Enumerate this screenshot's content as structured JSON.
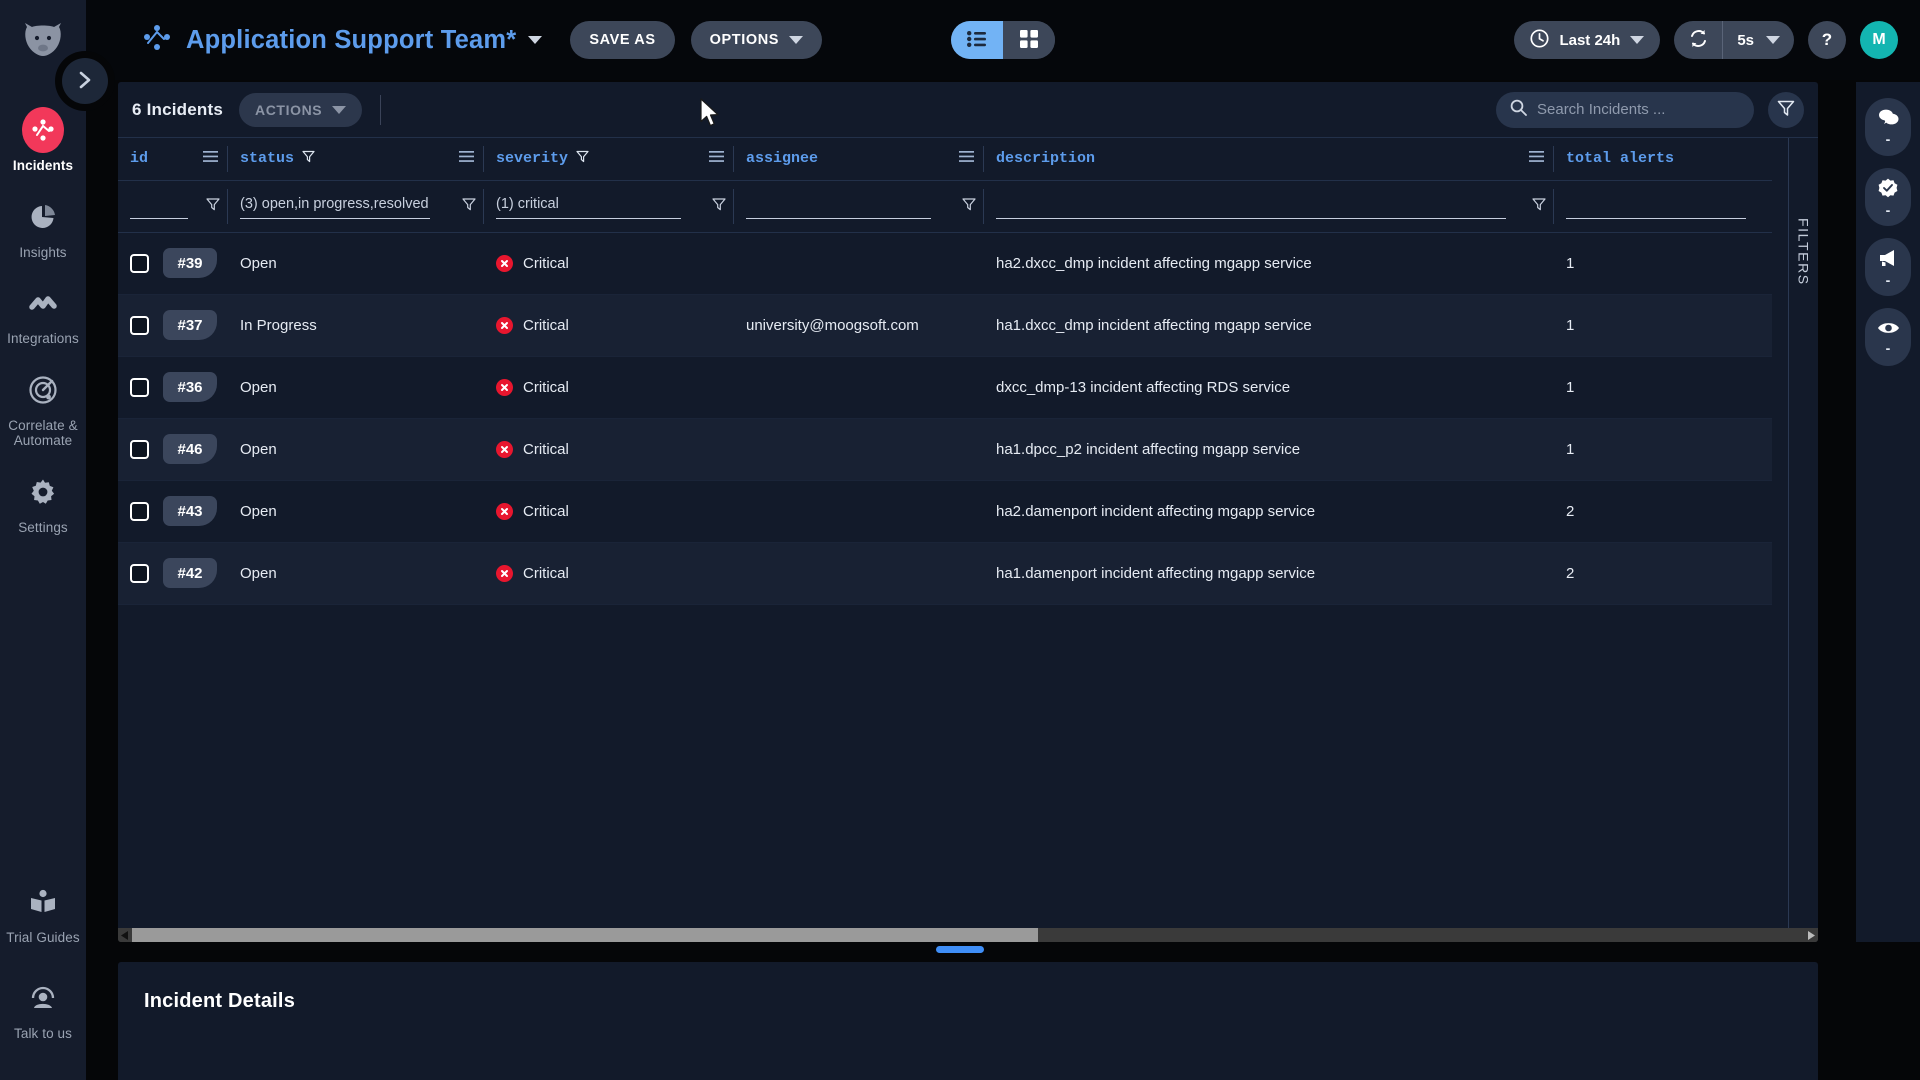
{
  "app": {
    "brand_icon": "moogsoft-cow-logo",
    "accent_blue": "#5d9cec",
    "accent_red": "#f2385a",
    "critical_red": "#e8162e",
    "avatar_teal": "#13b5b1",
    "panel_bg": "#121a2a"
  },
  "sidebar": {
    "collapse_icon": "chevron-right-icon",
    "items": [
      {
        "label": "Incidents",
        "icon": "incidents-icon",
        "active": true
      },
      {
        "label": "Insights",
        "icon": "pie-chart-icon",
        "active": false
      },
      {
        "label": "Integrations",
        "icon": "integrations-icon",
        "active": false
      },
      {
        "label": "Correlate & Automate",
        "icon": "target-icon",
        "active": false
      },
      {
        "label": "Settings",
        "icon": "gear-icon",
        "active": false
      }
    ],
    "bottom_items": [
      {
        "label": "Trial Guides",
        "icon": "book-icon"
      },
      {
        "label": "Talk to us",
        "icon": "headset-icon"
      }
    ]
  },
  "topbar": {
    "dashboard_title": "Application Support Team*",
    "dashboard_caret": "chevron-down-icon",
    "save_as_label": "SAVE AS",
    "options_label": "OPTIONS",
    "view_toggle": {
      "list_icon": "list-view-icon",
      "grid_icon": "grid-view-icon",
      "active": "list"
    },
    "time_range": {
      "icon": "clock-icon",
      "label": "Last 24h",
      "caret": "chevron-down-icon"
    },
    "refresh": {
      "icon": "refresh-icon",
      "interval": "5s",
      "caret": "chevron-down-icon"
    },
    "help_label": "?",
    "avatar_initial": "M"
  },
  "toolbar": {
    "incident_count": "6 Incidents",
    "actions_label": "ACTIONS",
    "actions_caret": "chevron-down-icon",
    "search_icon": "search-icon",
    "search_placeholder": "Search Incidents ...",
    "search_value": "",
    "filter_icon": "funnel-icon"
  },
  "table": {
    "columns": [
      {
        "key": "id",
        "label": "id",
        "has_sort": false,
        "menu_icon": "column-menu-icon"
      },
      {
        "key": "status",
        "label": "status",
        "has_sort": true,
        "menu_icon": "column-menu-icon"
      },
      {
        "key": "severity",
        "label": "severity",
        "has_sort": true,
        "menu_icon": "column-menu-icon"
      },
      {
        "key": "assignee",
        "label": "assignee",
        "has_sort": false,
        "menu_icon": "column-menu-icon"
      },
      {
        "key": "description",
        "label": "description",
        "has_sort": false,
        "menu_icon": "column-menu-icon"
      },
      {
        "key": "total_alerts",
        "label": "total alerts",
        "has_sort": false,
        "menu_icon": null
      }
    ],
    "filters": {
      "id": "",
      "status": "(3) open,in progress,resolved",
      "severity": "(1) critical",
      "assignee": "",
      "description": "",
      "total_alerts": "",
      "funnel_icon": "funnel-icon"
    },
    "rows": [
      {
        "id": "#39",
        "status": "Open",
        "severity": "Critical",
        "assignee": "",
        "description": "ha2.dxcc_dmp incident affecting mgapp service",
        "total_alerts": "1"
      },
      {
        "id": "#37",
        "status": "In Progress",
        "severity": "Critical",
        "assignee": "university@moogsoft.com",
        "description": "ha1.dxcc_dmp incident affecting mgapp service",
        "total_alerts": "1"
      },
      {
        "id": "#36",
        "status": "Open",
        "severity": "Critical",
        "assignee": "",
        "description": "dxcc_dmp-13 incident affecting RDS service",
        "total_alerts": "1"
      },
      {
        "id": "#46",
        "status": "Open",
        "severity": "Critical",
        "assignee": "",
        "description": "ha1.dpcc_p2 incident affecting mgapp service",
        "total_alerts": "1"
      },
      {
        "id": "#43",
        "status": "Open",
        "severity": "Critical",
        "assignee": "",
        "description": "ha2.damenport incident affecting mgapp service",
        "total_alerts": "2"
      },
      {
        "id": "#42",
        "status": "Open",
        "severity": "Critical",
        "assignee": "",
        "description": "ha1.damenport incident affecting mgapp service",
        "total_alerts": "2"
      }
    ],
    "filters_rail_label": "FILTERS",
    "hscroll": {
      "left_arrow": "scroll-left-arrow-icon",
      "right_arrow": "scroll-right-arrow-icon"
    }
  },
  "right_rail": {
    "buttons": [
      {
        "icon": "comments-icon",
        "count": "-"
      },
      {
        "icon": "verified-icon",
        "count": "-"
      },
      {
        "icon": "megaphone-icon",
        "count": "-"
      },
      {
        "icon": "eye-icon",
        "count": "-"
      }
    ]
  },
  "details": {
    "title": "Incident Details"
  }
}
